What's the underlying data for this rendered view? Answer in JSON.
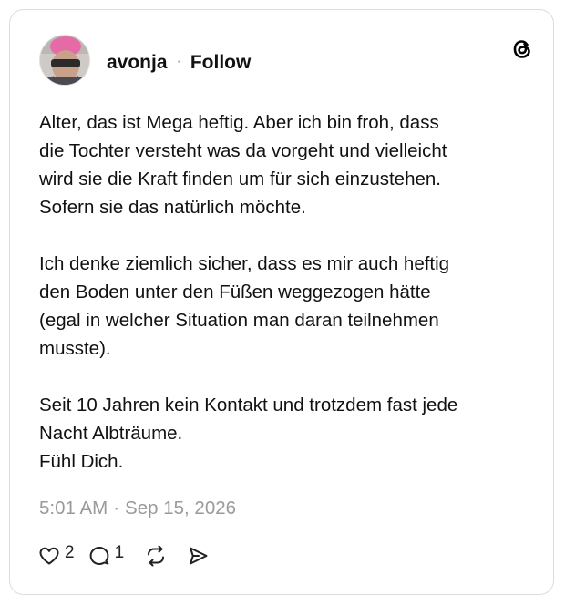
{
  "post": {
    "author": {
      "username": "avonja",
      "separator": "·",
      "follow_label": "Follow",
      "avatar_icon": "user-avatar-photo"
    },
    "brand_icon": "threads-logo-icon",
    "paragraphs": [
      "Alter, das ist Mega heftig. Aber ich bin froh, dass\ndie Tochter versteht was da vorgeht und vielleicht\nwird sie die Kraft finden um für sich einzustehen.\nSofern sie das natürlich möchte.",
      "Ich denke ziemlich sicher, dass es mir auch heftig\nden Boden unter den Füßen weggezogen hätte\n(egal in welcher Situation man daran teilnehmen\nmusste).",
      "Seit 10 Jahren kein Kontakt und trotzdem fast jede\nNacht Albträume.\nFühl Dich."
    ],
    "time": "5:01 AM",
    "time_separator": "·",
    "date": "Sep 15, 2026",
    "actions": {
      "like": {
        "icon": "heart-icon",
        "count": "2"
      },
      "reply": {
        "icon": "speech-bubble-icon",
        "count": "1"
      },
      "repost": {
        "icon": "repost-icon"
      },
      "share": {
        "icon": "send-icon"
      }
    }
  }
}
